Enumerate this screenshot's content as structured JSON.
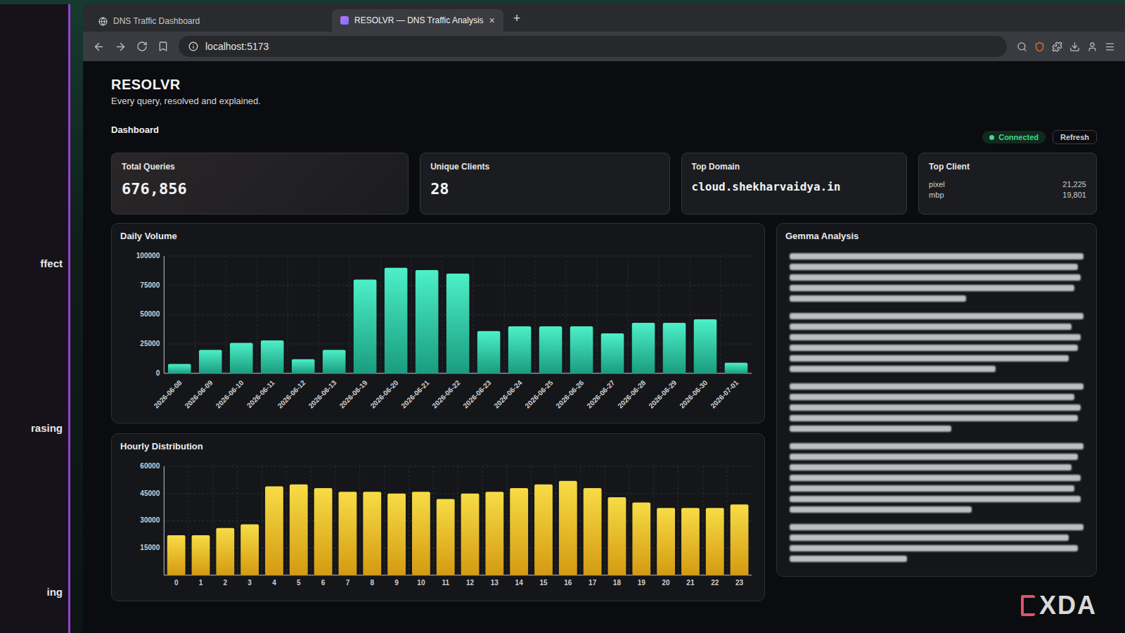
{
  "side_window": {
    "fragments": [
      "ffect",
      "rasing",
      "ing"
    ]
  },
  "browser": {
    "tabs": [
      {
        "label": "DNS Traffic Dashboard",
        "selected": false
      },
      {
        "label": "RESOLVR — DNS Traffic Analysis",
        "selected": true
      }
    ],
    "close_glyph": "×",
    "new_tab": "+",
    "address": "localhost:5173"
  },
  "app": {
    "brand": "RESOLVR",
    "tagline": "Every query, resolved and explained.",
    "nav": [
      {
        "label": "Dashboard",
        "selected": true
      }
    ],
    "status": {
      "label": "Connected",
      "online": true
    },
    "refresh": "Refresh"
  },
  "cards": [
    {
      "kind": "stat",
      "label": "Total Queries",
      "value": "676,856"
    },
    {
      "kind": "stat",
      "label": "Unique Clients",
      "value": "28"
    },
    {
      "kind": "domain",
      "label": "Top Domain",
      "value": "cloud.shekharvaidya.in"
    },
    {
      "kind": "list",
      "label": "Top Client",
      "rows": [
        {
          "name": "pixel",
          "count": "21,225"
        },
        {
          "name": "mbp",
          "count": "19,801"
        }
      ]
    }
  ],
  "daily_volume": {
    "title": "Daily Volume",
    "y_ticks": [
      "0",
      "25000",
      "50000",
      "75000",
      "100000"
    ],
    "labels": [
      "2026-06-08",
      "2026-06-09",
      "2026-06-10",
      "2026-06-11",
      "2026-06-12",
      "2026-06-13",
      "2026-06-19",
      "2026-06-20",
      "2026-06-21",
      "2026-06-22",
      "2026-06-23",
      "2026-06-24",
      "2026-06-25",
      "2026-06-26",
      "2026-06-27",
      "2026-06-28",
      "2026-06-29",
      "2026-06-30",
      "2026-07-01"
    ],
    "values": [
      8000,
      20000,
      26000,
      28000,
      12000,
      20000,
      80000,
      90000,
      88000,
      85000,
      36000,
      40000,
      40000,
      40000,
      34000,
      43000,
      43000,
      46000,
      9000
    ]
  },
  "hourly_distribution": {
    "title": "Hourly Distribution",
    "y_ticks": [
      "15000",
      "30000",
      "45000",
      "60000"
    ],
    "labels": [
      "0",
      "1",
      "2",
      "3",
      "4",
      "5",
      "6",
      "7",
      "8",
      "9",
      "10",
      "11",
      "12",
      "13",
      "14",
      "15",
      "16",
      "17",
      "18",
      "19",
      "20",
      "21",
      "22",
      "23"
    ],
    "values": [
      22000,
      22000,
      26000,
      28000,
      49000,
      50000,
      48000,
      46000,
      46000,
      45000,
      46000,
      42000,
      45000,
      46000,
      48000,
      50000,
      52000,
      48000,
      43000,
      40000,
      37000,
      37000,
      37000,
      39000
    ]
  },
  "analysis": {
    "title": "Gemma Analysis"
  },
  "watermark": "XDA"
}
